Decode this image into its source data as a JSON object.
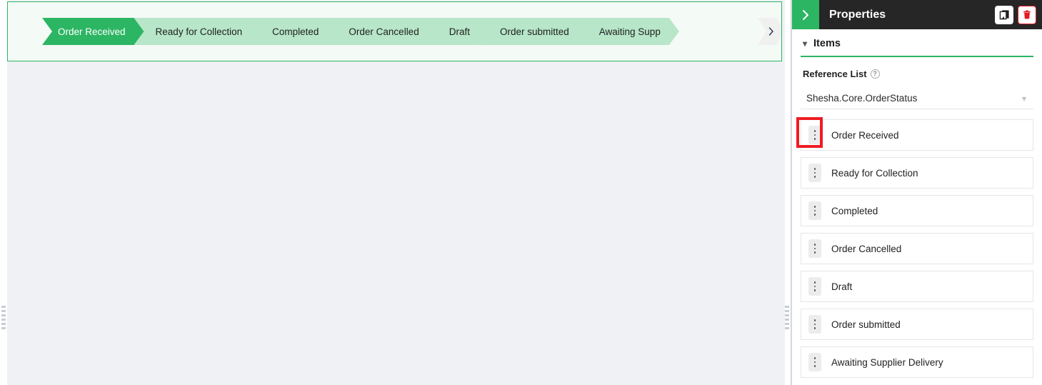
{
  "designer": {
    "widget": {
      "name": "status-chevron-widget",
      "steps": [
        {
          "label": "Order Received",
          "active": true
        },
        {
          "label": "Ready for Collection",
          "active": false
        },
        {
          "label": "Completed",
          "active": false
        },
        {
          "label": "Order Cancelled",
          "active": false
        },
        {
          "label": "Draft",
          "active": false
        },
        {
          "label": "Order submitted",
          "active": false
        },
        {
          "label": "Awaiting Supp",
          "active": false
        }
      ],
      "scroll_right_icon": "chevron-right-icon"
    },
    "colors": {
      "active_step": "#2cb563",
      "inactive_step": "#b7e6c9",
      "canvas_bg": "#eff1f5",
      "widget_bg": "#f4faf5",
      "selection_border": "#2cb563"
    }
  },
  "properties": {
    "header": {
      "collapse_icon": "chevron-right-icon",
      "title": "Properties",
      "copy_icon": "copy-icon",
      "delete_icon": "trash-icon",
      "delete_color": "#e41b23"
    },
    "section": {
      "caret_icon": "chevron-down-icon",
      "title": "Items"
    },
    "reference_list": {
      "label": "Reference List",
      "help_icon": "question-circle-icon",
      "help_glyph": "?",
      "selected_value": "Shesha.Core.OrderStatus",
      "caret_icon": "chevron-down-icon"
    },
    "items": [
      {
        "label": "Order Received",
        "handle_icon": "drag-handle-icon",
        "highlighted": true
      },
      {
        "label": "Ready for Collection",
        "handle_icon": "drag-handle-icon",
        "highlighted": false
      },
      {
        "label": "Completed",
        "handle_icon": "drag-handle-icon",
        "highlighted": false
      },
      {
        "label": "Order Cancelled",
        "handle_icon": "drag-handle-icon",
        "highlighted": false
      },
      {
        "label": "Draft",
        "handle_icon": "drag-handle-icon",
        "highlighted": false
      },
      {
        "label": "Order submitted",
        "handle_icon": "drag-handle-icon",
        "highlighted": false
      },
      {
        "label": "Awaiting Supplier Delivery",
        "handle_icon": "drag-handle-icon",
        "highlighted": false
      }
    ],
    "annotation": {
      "highlight_color": "#ee1c25",
      "target": "drag-handle-order-received"
    }
  }
}
